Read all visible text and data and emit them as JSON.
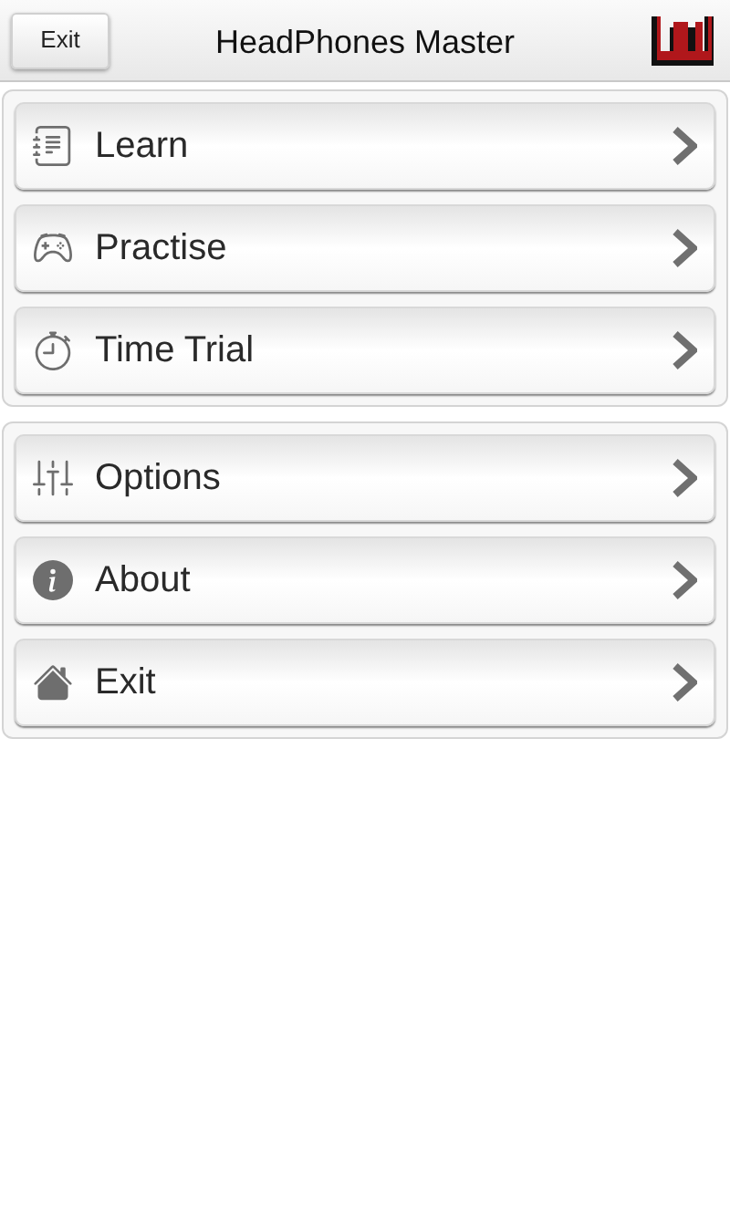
{
  "header": {
    "exit_button": "Exit",
    "title": "HeadPhones Master"
  },
  "menu_groups": [
    {
      "items": [
        "Learn",
        "Practise",
        "Time Trial"
      ]
    },
    {
      "items": [
        "Options",
        "About",
        "Exit"
      ]
    }
  ]
}
